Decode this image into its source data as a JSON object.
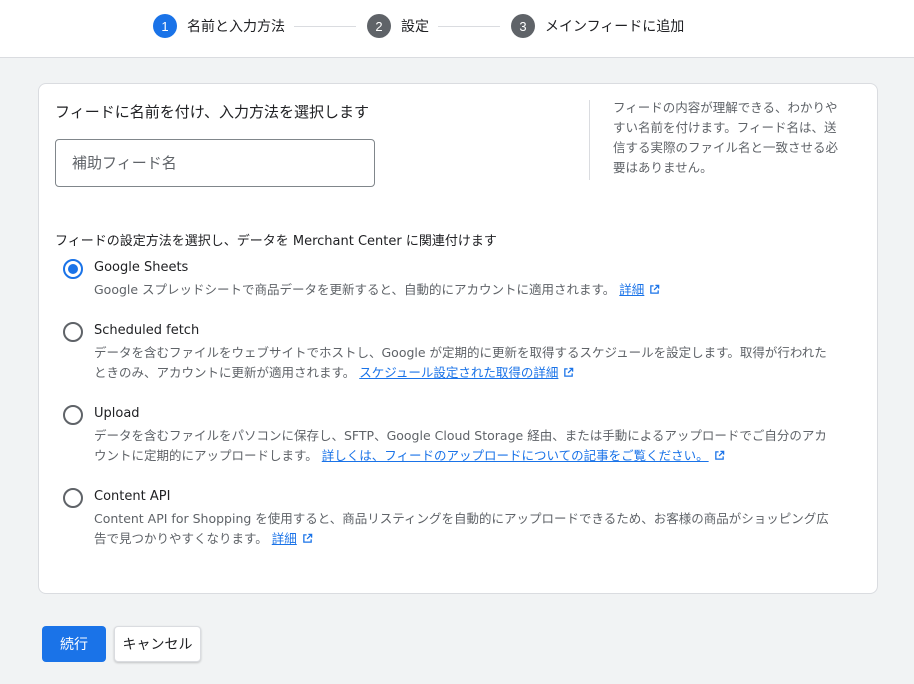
{
  "stepper": {
    "steps": [
      {
        "number": "1",
        "label": "名前と入力方法",
        "state": "active"
      },
      {
        "number": "2",
        "label": "設定",
        "state": "inactive"
      },
      {
        "number": "3",
        "label": "メインフィードに追加",
        "state": "inactive"
      }
    ]
  },
  "form": {
    "title": "フィードに名前を付け、入力方法を選択します",
    "name_input": {
      "placeholder": "補助フィード名",
      "value": ""
    },
    "help_text": "フィードの内容が理解できる、わかりやすい名前を付けます。フィード名は、送信する実際のファイル名と一致させる必要はありません。",
    "section_title": "フィードの設定方法を選択し、データを Merchant Center に関連付けます",
    "options": [
      {
        "label": "Google Sheets",
        "checked": true,
        "description": "Google スプレッドシートで商品データを更新すると、自動的にアカウントに適用されます。",
        "link": "詳細"
      },
      {
        "label": "Scheduled fetch",
        "checked": false,
        "description": "データを含むファイルをウェブサイトでホストし、Google が定期的に更新を取得するスケジュールを設定します。取得が行われたときのみ、アカウントに更新が適用されます。",
        "link": "スケジュール設定された取得の詳細"
      },
      {
        "label": "Upload",
        "checked": false,
        "description": "データを含むファイルをパソコンに保存し、SFTP、Google Cloud Storage 経由、または手動によるアップロードでご自分のアカウントに定期的にアップロードします。",
        "link": "詳しくは、フィードのアップロードについての記事をご覧ください。"
      },
      {
        "label": "Content API",
        "checked": false,
        "description": "Content API for Shopping を使用すると、商品リスティングを自動的にアップロードできるため、お客様の商品がショッピング広告で見つかりやすくなります。",
        "link": "詳細"
      }
    ]
  },
  "actions": {
    "continue_label": "続行",
    "cancel_label": "キャンセル"
  },
  "colors": {
    "accent": "#1a73e8",
    "inactive_step": "#5f6368",
    "page_background": "#f1f3f4"
  }
}
